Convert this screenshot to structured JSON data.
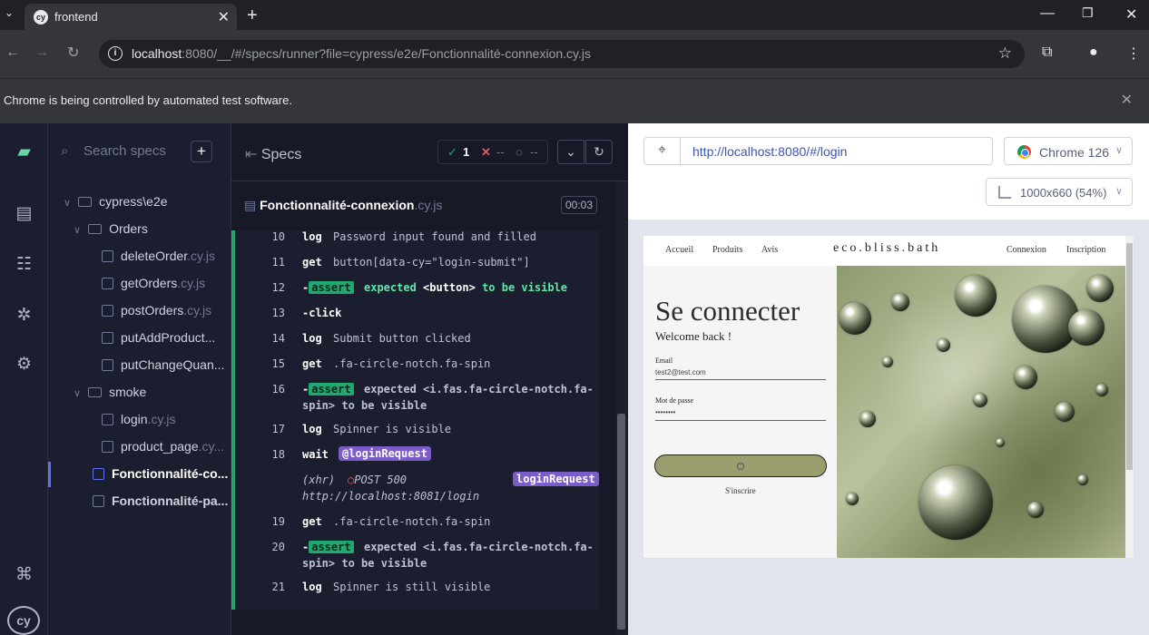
{
  "browser": {
    "tab_title": "frontend",
    "url_host": "localhost",
    "url_rest": ":8080/__/#/specs/runner?file=cypress/e2e/Fonctionnalité-connexion.cy.js",
    "infobar_message": "Chrome is being controlled by automated test software."
  },
  "sidebar": {
    "search_placeholder": "Search specs",
    "tree": [
      {
        "label": "cypress\\e2e",
        "type": "folder"
      },
      {
        "label": "Orders",
        "type": "folder"
      },
      {
        "label": "deleteOrder",
        "ext": ".cy.js"
      },
      {
        "label": "getOrders",
        "ext": ".cy.js"
      },
      {
        "label": "postOrders",
        "ext": ".cy.js"
      },
      {
        "label": "putAddProduct...",
        "ext": ""
      },
      {
        "label": "putChangeQuan...",
        "ext": ""
      },
      {
        "label": "smoke",
        "type": "folder"
      },
      {
        "label": "login",
        "ext": ".cy.js"
      },
      {
        "label": "product_page",
        "ext": ".cy..."
      },
      {
        "label": "Fonctionnalité-co...",
        "ext": ""
      },
      {
        "label": "Fonctionnalité-pa...",
        "ext": ""
      }
    ]
  },
  "reporter": {
    "header_label": "Specs",
    "passed": "1",
    "failed": "--",
    "pending": "--",
    "spec_name": "Fonctionnalité-connexion",
    "spec_ext": ".cy.js",
    "duration": "00:03",
    "commands": [
      {
        "num": "10",
        "name": "log",
        "msg": "Password input found and filled"
      },
      {
        "num": "11",
        "name": "get",
        "msg": "button[data-cy=\"login-submit\"]"
      },
      {
        "num": "12",
        "name": "assert",
        "msg_parts": [
          "expected",
          "<button>",
          "to be",
          "visible"
        ]
      },
      {
        "num": "13",
        "name": "-click",
        "msg": ""
      },
      {
        "num": "14",
        "name": "log",
        "msg": "Submit button clicked"
      },
      {
        "num": "15",
        "name": "get",
        "msg": ".fa-circle-notch.fa-spin"
      },
      {
        "num": "16",
        "name": "assert",
        "line1": "expected <i.fas.fa-circle-notch.fa-",
        "line2": "spin> to be visible"
      },
      {
        "num": "17",
        "name": "log",
        "msg": "Spinner is visible"
      },
      {
        "num": "18",
        "name": "wait",
        "msg": "@loginRequest"
      },
      {
        "num": "",
        "name": "(xhr)",
        "msg": "POST 500",
        "alias": "loginRequest",
        "url": "http://localhost:8081/login"
      },
      {
        "num": "19",
        "name": "get",
        "msg": ".fa-circle-notch.fa-spin"
      },
      {
        "num": "20",
        "name": "assert",
        "line1": "expected <i.fas.fa-circle-notch.fa-",
        "line2": "spin> to be visible"
      },
      {
        "num": "21",
        "name": "log",
        "msg": "Spinner is still visible"
      }
    ]
  },
  "aut": {
    "url": "http://localhost:8080/#/login",
    "browser": "Chrome 126",
    "viewport": "1000x660 (54%)"
  },
  "app": {
    "nav_accueil": "Accueil",
    "nav_produits": "Produits",
    "nav_avis": "Avis",
    "brand": "eco.bliss.bath",
    "nav_connexion": "Connexion",
    "nav_inscription": "Inscription",
    "heading": "Se connecter",
    "welcome": "Welcome back !",
    "email_label": "Email",
    "email_value": "test2@test.com",
    "password_label": "Mot de passe",
    "password_value": "••••••••",
    "signup_link": "S'inscrire"
  },
  "colors": {
    "accent_green": "#1fa971",
    "alias_purple": "#7b5cc9",
    "active_indicator": "#6470f3"
  }
}
